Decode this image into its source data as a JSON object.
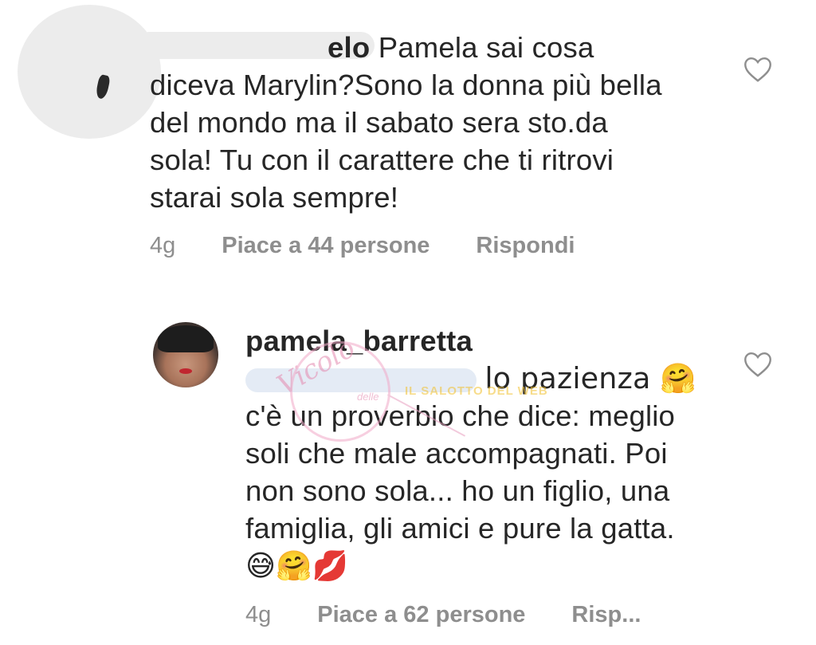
{
  "comment1": {
    "username_visible": "elo",
    "lines": [
      "Pamela sai cosa",
      "diceva Marylin?Sono la donna più bella",
      "del mondo ma il sabato sera sto.da",
      "sola! Tu con il carattere che ti ritrovi",
      "starai sola sempre!"
    ],
    "time": "4g",
    "likes": "Piace a 44 persone",
    "reply": "Rispondi"
  },
  "comment2": {
    "username": "pamela_barretta",
    "lines": [
      "lo pazienza 🤗",
      "c'è un proverbio che dice: meglio",
      "soli che male accompagnati. Poi",
      "non sono sola... ho un figlio, una",
      "famiglia, gli amici e pure la gatta.",
      "😅🤗💋"
    ],
    "time": "4g",
    "likes": "Piace a 62 persone",
    "reply": "Risp..."
  },
  "watermark": {
    "title": "Vicolo",
    "word_small": "delle",
    "subtitle": "IL SALOTTO DEL WEB"
  },
  "icons": {
    "like": "heart-outline-icon",
    "heart_color": "#8e8e8e",
    "meta_color": "#8e8e8e"
  }
}
